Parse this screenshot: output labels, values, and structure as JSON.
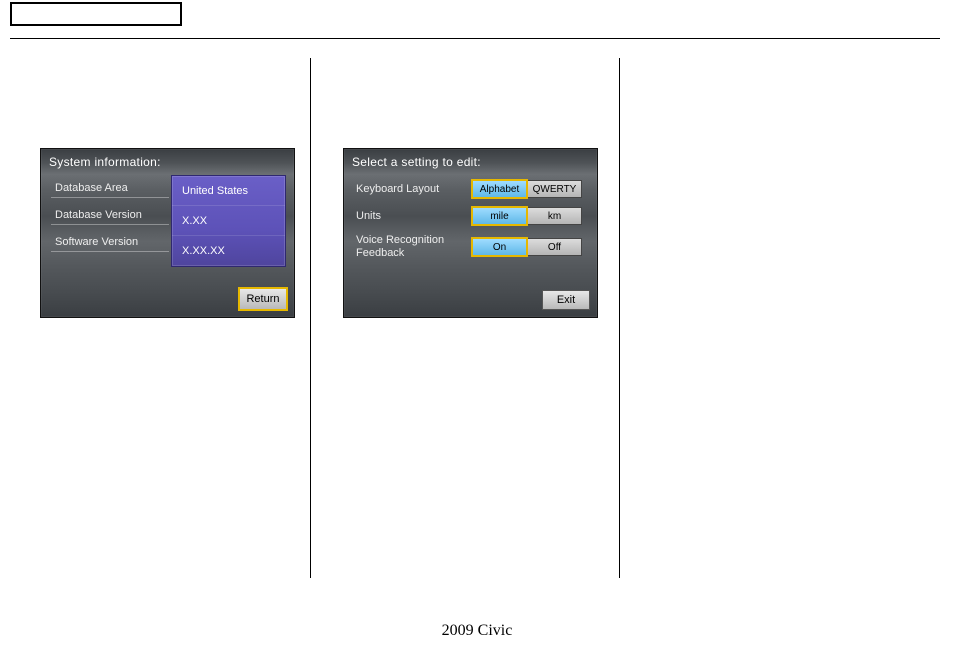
{
  "footer_text": "2009  Civic",
  "panel1": {
    "title": "System information:",
    "rows": [
      {
        "label": "Database Area",
        "value": "United States"
      },
      {
        "label": "Database Version",
        "value": "X.XX"
      },
      {
        "label": "Software Version",
        "value": "X.XX.XX"
      }
    ],
    "return_label": "Return"
  },
  "panel2": {
    "title": "Select a setting to edit:",
    "rows": [
      {
        "label": "Keyboard Layout",
        "opt_sel": "Alphabet",
        "opt_unsel": "QWERTY"
      },
      {
        "label": "Units",
        "opt_sel": "mile",
        "opt_unsel": "km"
      },
      {
        "label": "Voice Recognition Feedback",
        "opt_sel": "On",
        "opt_unsel": "Off"
      }
    ],
    "exit_label": "Exit"
  }
}
